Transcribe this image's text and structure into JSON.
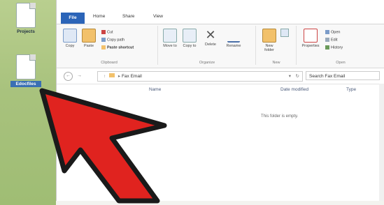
{
  "desktop": {
    "icons": [
      {
        "label": "Projects"
      },
      {
        "label": "Edocfiles"
      }
    ]
  },
  "ribbon": {
    "tabs": [
      "File",
      "Home",
      "Share",
      "View"
    ],
    "clipboard": {
      "copy": "Copy",
      "paste": "Paste",
      "cut": "Cut",
      "copy_path": "Copy path",
      "paste_shortcut": "Paste shortcut",
      "group": "Clipboard"
    },
    "organize": {
      "move_to": "Move to",
      "copy_to": "Copy to",
      "delete": "Delete",
      "rename": "Rename",
      "group": "Organize"
    },
    "new": {
      "new_folder": "New folder",
      "group": "New"
    },
    "open": {
      "properties": "Properties",
      "open": "Open",
      "edit": "Edit",
      "history": "History",
      "group": "Open"
    }
  },
  "address": {
    "path": "Fax Email",
    "search_placeholder": "Search Fax Email"
  },
  "columns": {
    "name": "Name",
    "date_modified": "Date modified",
    "type": "Type"
  },
  "empty_message": "This folder is empty."
}
